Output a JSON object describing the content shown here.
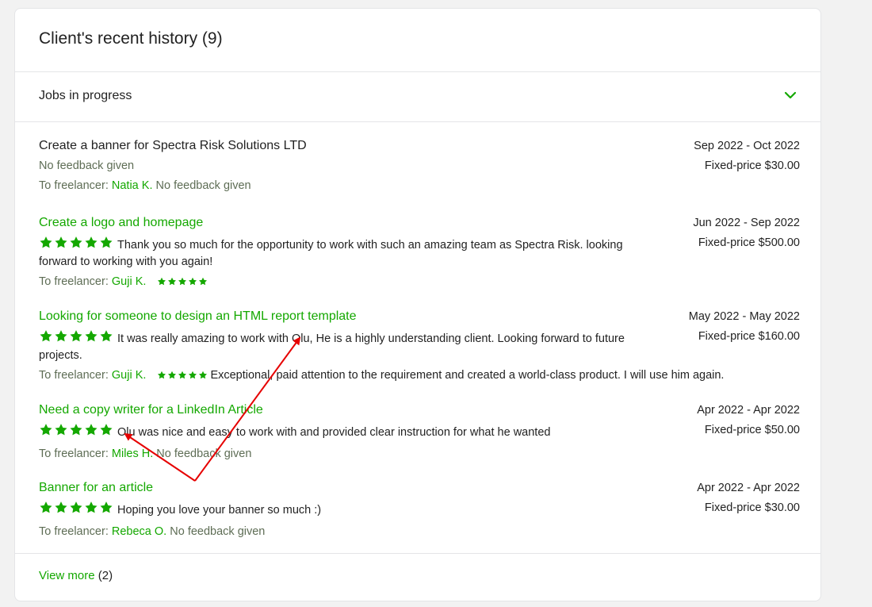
{
  "header": {
    "title": "Client's recent history (9)"
  },
  "section": {
    "label": "Jobs in progress"
  },
  "colors": {
    "accent": "#14a800",
    "star": "#14a800",
    "annotation": "#e60000"
  },
  "jobs": [
    {
      "title": "Create a banner for Spectra Risk Solutions LTD",
      "dates": "Sep 2022 - Oct 2022",
      "price": "Fixed-price $30.00",
      "client_feedback": "No feedback given",
      "to_label": "To freelancer:",
      "freelancer": "Natia K.",
      "freelancer_feedback": "No feedback given"
    },
    {
      "title": "Create a logo and homepage",
      "dates": "Jun 2022 - Sep 2022",
      "price": "Fixed-price $500.00",
      "client_rating": 5,
      "client_feedback": "Thank you so much for the opportunity to work with such an amazing team as Spectra Risk. looking forward to working with you again!",
      "to_label": "To freelancer:",
      "freelancer": "Guji K.",
      "freelancer_rating": 5,
      "freelancer_feedback": ""
    },
    {
      "title": "Looking for someone to design an HTML report template",
      "dates": "May 2022 - May 2022",
      "price": "Fixed-price $160.00",
      "client_rating": 5,
      "client_feedback": "It was really amazing to work with Olu, He is a highly understanding client. Looking forward to future projects.",
      "to_label": "To freelancer:",
      "freelancer": "Guji K.",
      "freelancer_rating": 5,
      "freelancer_feedback": "Exceptional, paid attention to the requirement and created a world-class product. I will use him again."
    },
    {
      "title": "Need a copy writer for a LinkedIn Article",
      "dates": "Apr 2022 - Apr 2022",
      "price": "Fixed-price $50.00",
      "client_rating": 5,
      "client_feedback": "Olu was nice and easy to work with and provided clear instruction for what he wanted",
      "to_label": "To freelancer:",
      "freelancer": "Miles H.",
      "freelancer_feedback": "No feedback given"
    },
    {
      "title": "Banner for an article",
      "dates": "Apr 2022 - Apr 2022",
      "price": "Fixed-price $30.00",
      "client_rating": 5,
      "client_feedback": "Hoping you love your banner so much :)",
      "to_label": "To freelancer:",
      "freelancer": "Rebeca O.",
      "freelancer_feedback": "No feedback given"
    }
  ],
  "footer": {
    "view_more": "View more",
    "view_more_count": "(2)"
  }
}
